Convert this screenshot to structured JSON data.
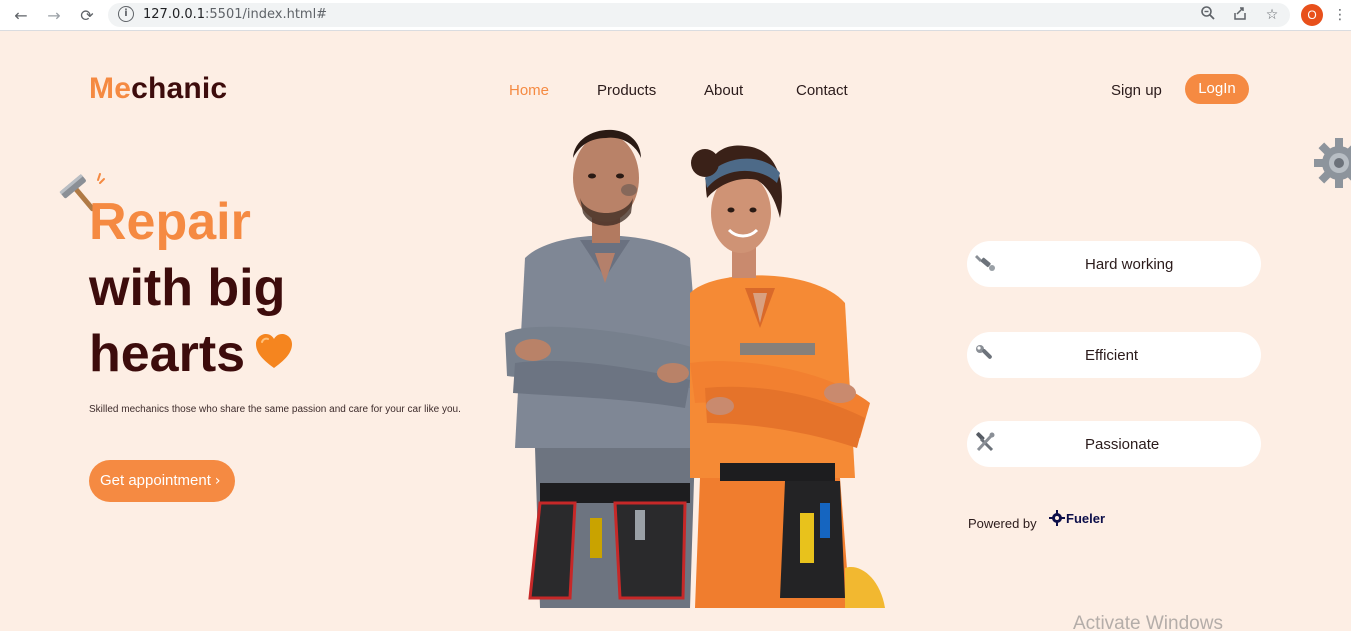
{
  "browser": {
    "url_host": "127.0.0.1",
    "url_rest": ":5501/index.html#",
    "profile_initial": "O"
  },
  "site": {
    "logo_prefix": "Me",
    "logo_suffix": "chanic",
    "nav": [
      {
        "label": "Home",
        "active": true
      },
      {
        "label": "Products",
        "active": false
      },
      {
        "label": "About",
        "active": false
      },
      {
        "label": "Contact",
        "active": false
      }
    ],
    "signup_label": "Sign up",
    "login_label": "LogIn"
  },
  "hero": {
    "line1": "Repair",
    "line2": "with big",
    "line3": "hearts",
    "tagline": "Skilled mechanics those who share the same passion and care for your car like you.",
    "cta_label": "Get appointment",
    "cta_chevron": "›"
  },
  "features": [
    {
      "label": "Hard working",
      "icon": "wrench-bolt-icon"
    },
    {
      "label": "Efficient",
      "icon": "wrench-icon"
    },
    {
      "label": "Passionate",
      "icon": "hammer-wrench-icon"
    }
  ],
  "powered": {
    "prefix": "Powered by",
    "brand": "Fueler"
  },
  "watermark": "Activate Windows",
  "colors": {
    "accent": "#f58a42",
    "dark": "#3d0c0c",
    "background": "#fdeee4"
  }
}
